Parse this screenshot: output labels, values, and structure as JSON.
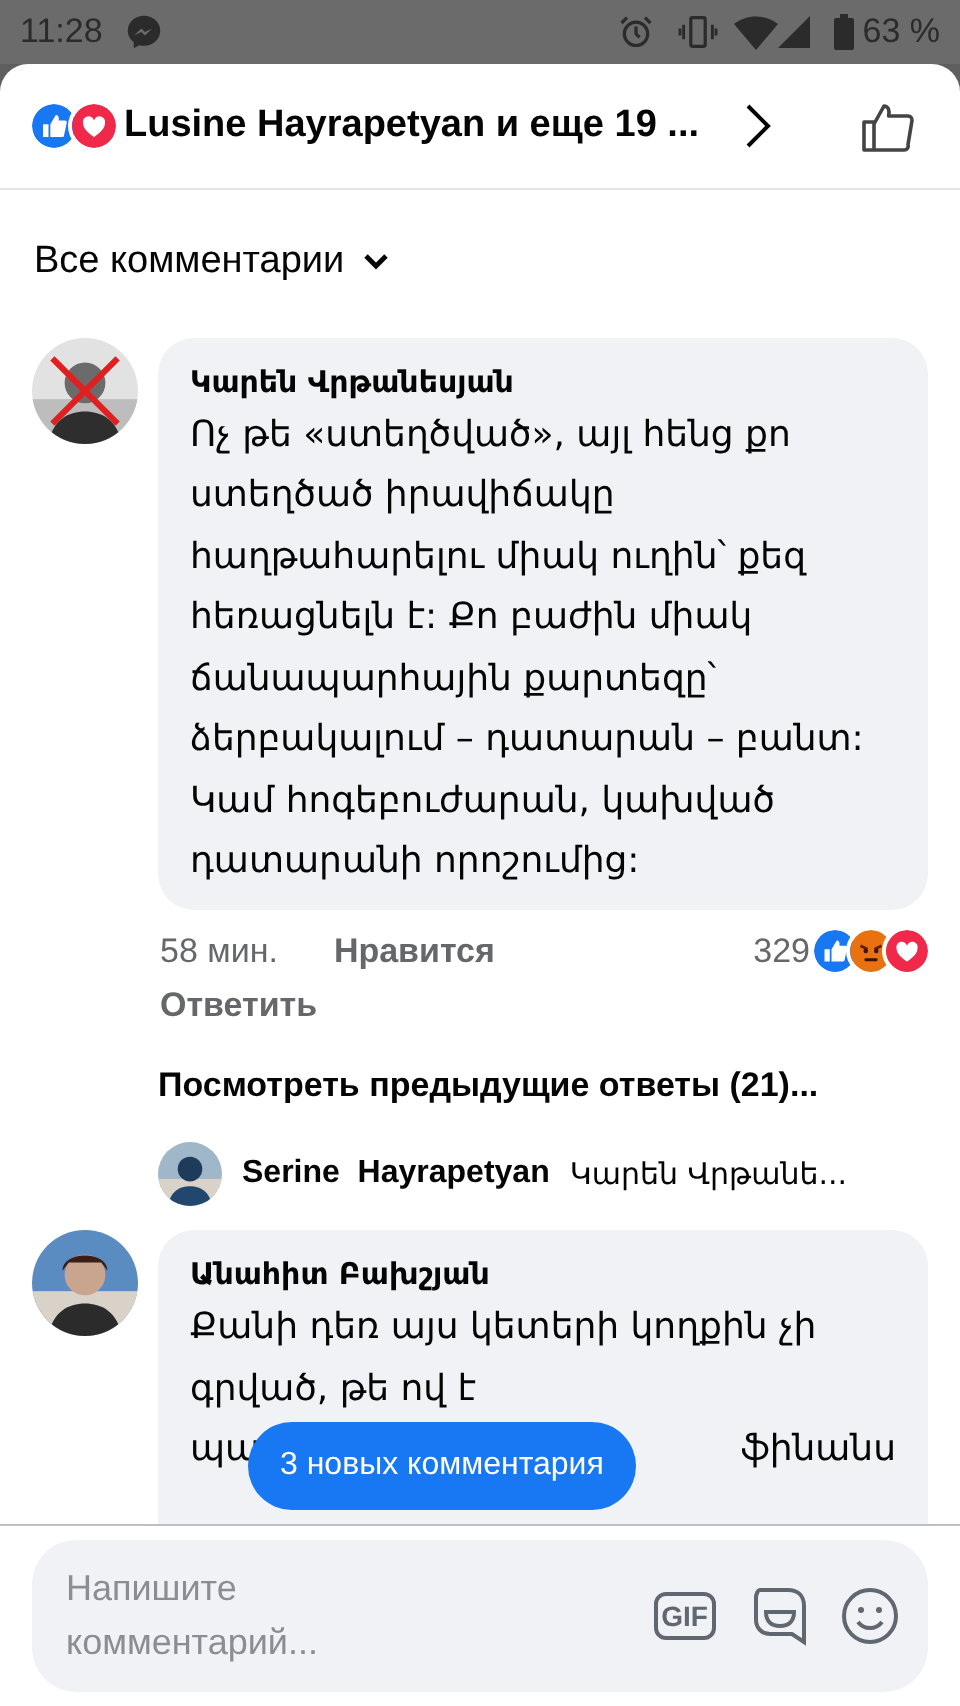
{
  "status_bar": {
    "time": "11:28",
    "battery": "63 %"
  },
  "header": {
    "reactions": [
      {
        "kind": "like"
      },
      {
        "kind": "love"
      }
    ],
    "title": "Lusine Hayrapetyan и еще 19 ..."
  },
  "filter": {
    "label": "Все комментарии"
  },
  "comments": [
    {
      "author": "Կարեն Վրթանեսյան",
      "text": "Ոչ թե «ստեղծված», այլ հենց քո ստեղծած իրավիճակը հաղթահարելու միակ ուղին՝ քեզ հեռացնելն է: Քո բաժին միակ ճանապարհային քարտեզը՝ ձերբակալում – դատարան – բանտ: Կամ հոգեբուժարան, կախված դատարանի որոշումից:",
      "time": "58 мин.",
      "like": "Нравится",
      "reply": "Ответить",
      "reaction_count": "329",
      "reactions": [
        {
          "kind": "like"
        },
        {
          "kind": "angry"
        },
        {
          "kind": "love"
        }
      ],
      "more_replies": "Посмотреть предыдущие ответы (21)...",
      "last_reply": {
        "author": "Serine  Hayrapetyan",
        "text": "Կարեն Վրթանե..."
      }
    },
    {
      "author": "Անահիտ Բախշյան",
      "lines": [
        "Քանի դեռ այս կետերի կողքին չի",
        "գրված, թե ով է"
      ],
      "covered_line": {
        "start": "պա",
        "end": "ֆինանս"
      }
    }
  ],
  "new_comments_pill": "3 новых комментария",
  "composer": {
    "placeholder": "Напишите комментарий...",
    "gif": "GIF"
  }
}
